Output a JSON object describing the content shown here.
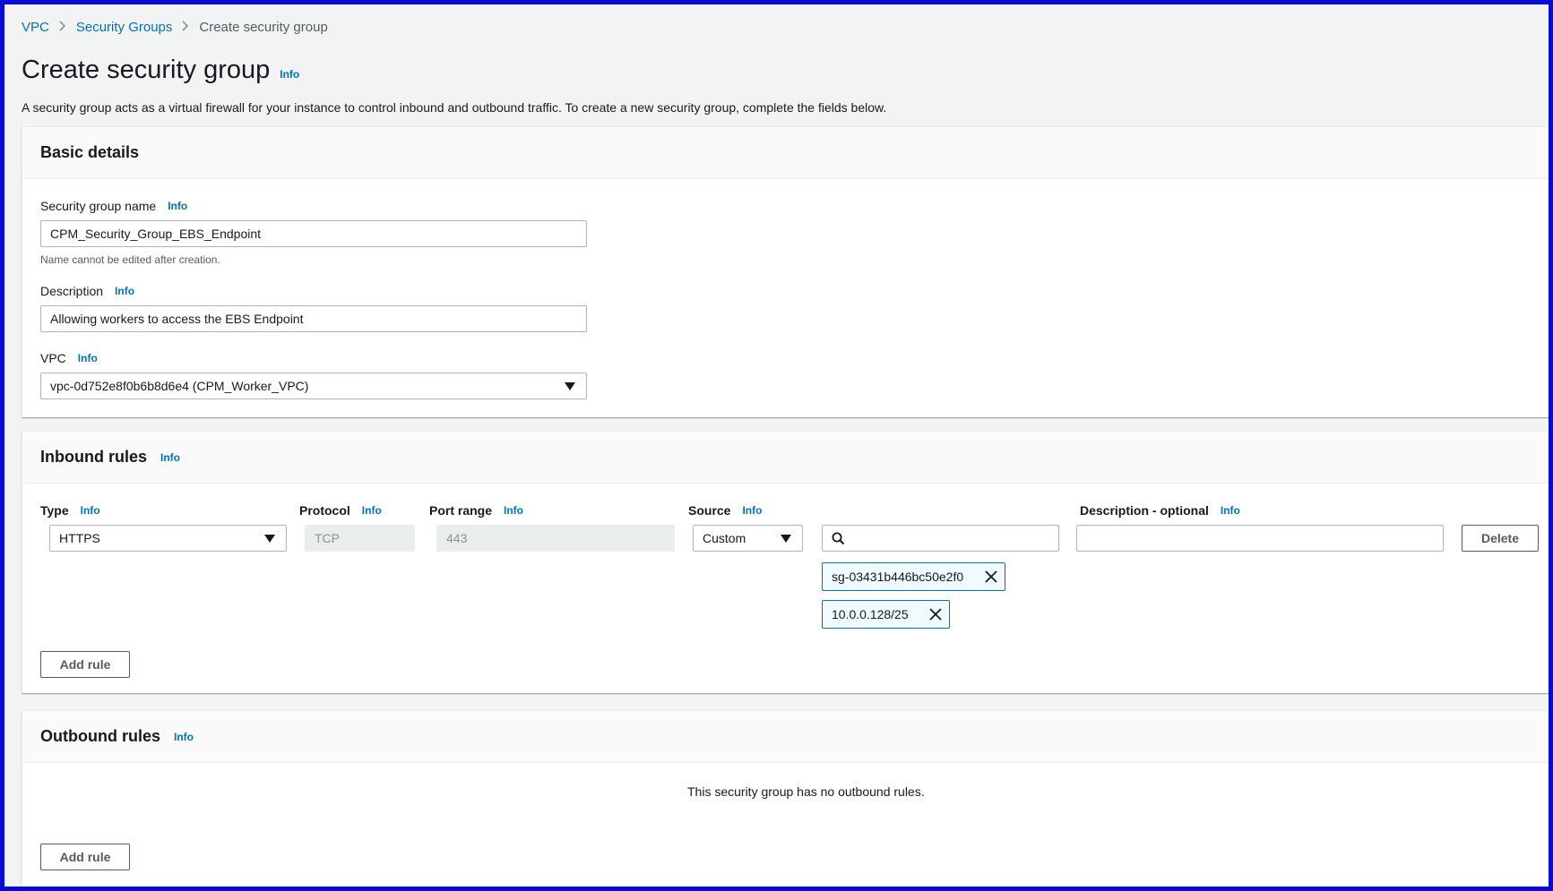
{
  "breadcrumb": {
    "items": [
      "VPC",
      "Security Groups"
    ],
    "current": "Create security group",
    "separator": ">"
  },
  "page": {
    "title": "Create security group",
    "info": "Info",
    "description": "A security group acts as a virtual firewall for your instance to control inbound and outbound traffic. To create a new security group, complete the fields below."
  },
  "basic_details": {
    "heading": "Basic details",
    "name_label": "Security group name",
    "name_value": "CPM_Security_Group_EBS_Endpoint",
    "name_hint": "Name cannot be edited after creation.",
    "description_label": "Description",
    "description_value": "Allowing workers to access the EBS Endpoint",
    "vpc_label": "VPC",
    "vpc_value": "vpc-0d752e8f0b6b8d6e4 (CPM_Worker_VPC)",
    "info": "Info"
  },
  "inbound": {
    "heading": "Inbound rules",
    "info": "Info",
    "columns": {
      "type": "Type",
      "protocol": "Protocol",
      "port_range": "Port range",
      "source": "Source",
      "description": "Description - optional"
    },
    "rule": {
      "type": "HTTPS",
      "protocol": "TCP",
      "port_range": "443",
      "source_mode": "Custom",
      "search_value": "",
      "description_value": "",
      "tokens": [
        "sg-03431b446bc50e2f0",
        "10.0.0.128/25"
      ],
      "delete_label": "Delete"
    },
    "add_rule_label": "Add rule"
  },
  "outbound": {
    "heading": "Outbound rules",
    "info": "Info",
    "empty_message": "This security group has no outbound rules.",
    "add_rule_label": "Add rule"
  },
  "colors": {
    "link": "#0073bb",
    "page_bg": "#f2f3f3",
    "token_border": "#0073bb",
    "frame_border": "#0b0bd6"
  }
}
